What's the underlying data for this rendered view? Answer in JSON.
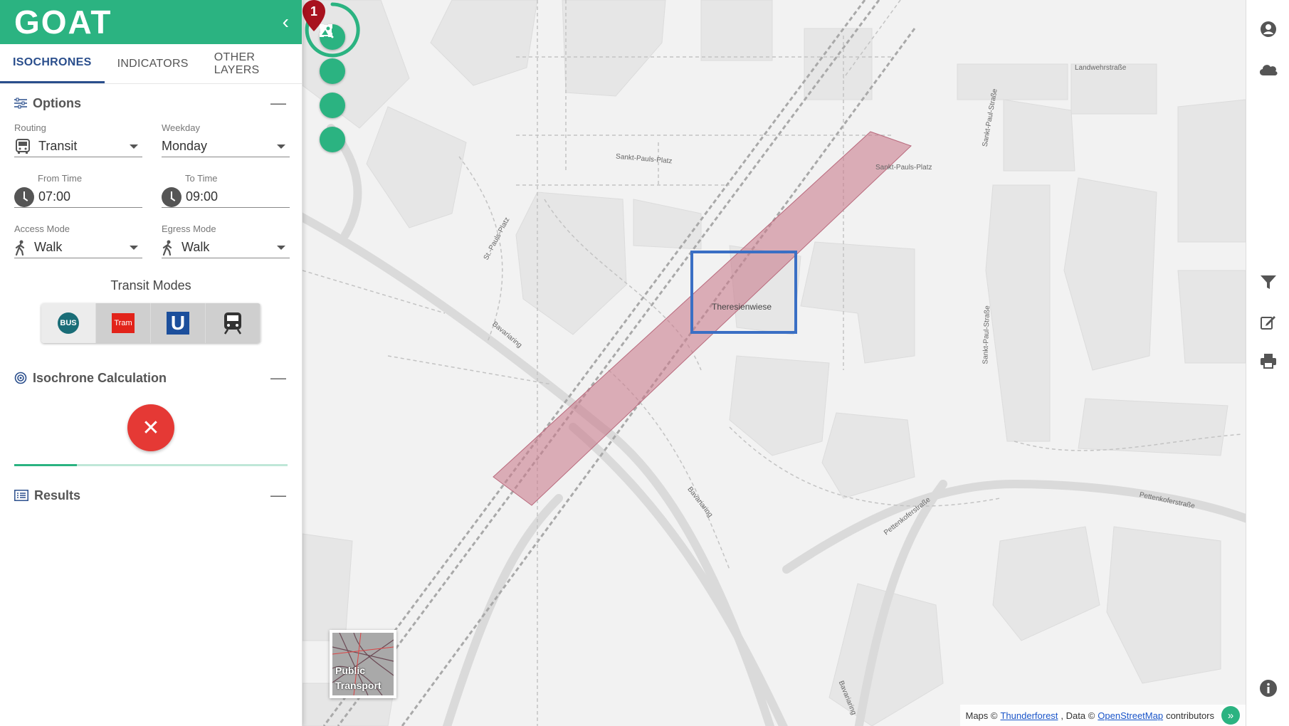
{
  "app": {
    "logo": "GOAT"
  },
  "tabs": [
    "ISOCHRONES",
    "INDICATORS",
    "OTHER LAYERS"
  ],
  "options": {
    "title": "Options",
    "routing": {
      "label": "Routing",
      "value": "Transit"
    },
    "weekday": {
      "label": "Weekday",
      "value": "Monday"
    },
    "from_time": {
      "label": "From Time",
      "value": "07:00"
    },
    "to_time": {
      "label": "To Time",
      "value": "09:00"
    },
    "access_mode": {
      "label": "Access Mode",
      "value": "Walk"
    },
    "egress_mode": {
      "label": "Egress Mode",
      "value": "Walk"
    },
    "transit_modes_title": "Transit Modes",
    "transit_modes": [
      "BUS",
      "Tram",
      "U",
      "rail"
    ]
  },
  "isochrone": {
    "title": "Isochrone Calculation",
    "progress": 0.23
  },
  "results": {
    "title": "Results"
  },
  "map": {
    "marker_number": "1",
    "marker_label": "Theresienwiese",
    "streets": [
      "Landwehrstraße",
      "Sankt-Pauls-Platz",
      "Sankt-Pauls-Platz",
      "St.-Pauls-Platz",
      "Bavariaring",
      "Bavariaring",
      "Bavariaring",
      "Pettenkoferstraße",
      "Pettenkoferstraße",
      "Sankt-Paul-Straße",
      "Sankt-Paul-Straße"
    ],
    "basemap_thumb_label": "Public Transport",
    "attribution": {
      "prefix": "Maps ©",
      "link1": "Thunderforest",
      "middle": ", Data ©",
      "link2": "OpenStreetMap",
      "suffix": "contributors"
    }
  },
  "colors": {
    "primary": "#2bb381",
    "tab_active": "#2a4e8c",
    "highlight": "#3a6fc4",
    "isochrone": "#c97d8e",
    "cancel": "#e53935"
  }
}
